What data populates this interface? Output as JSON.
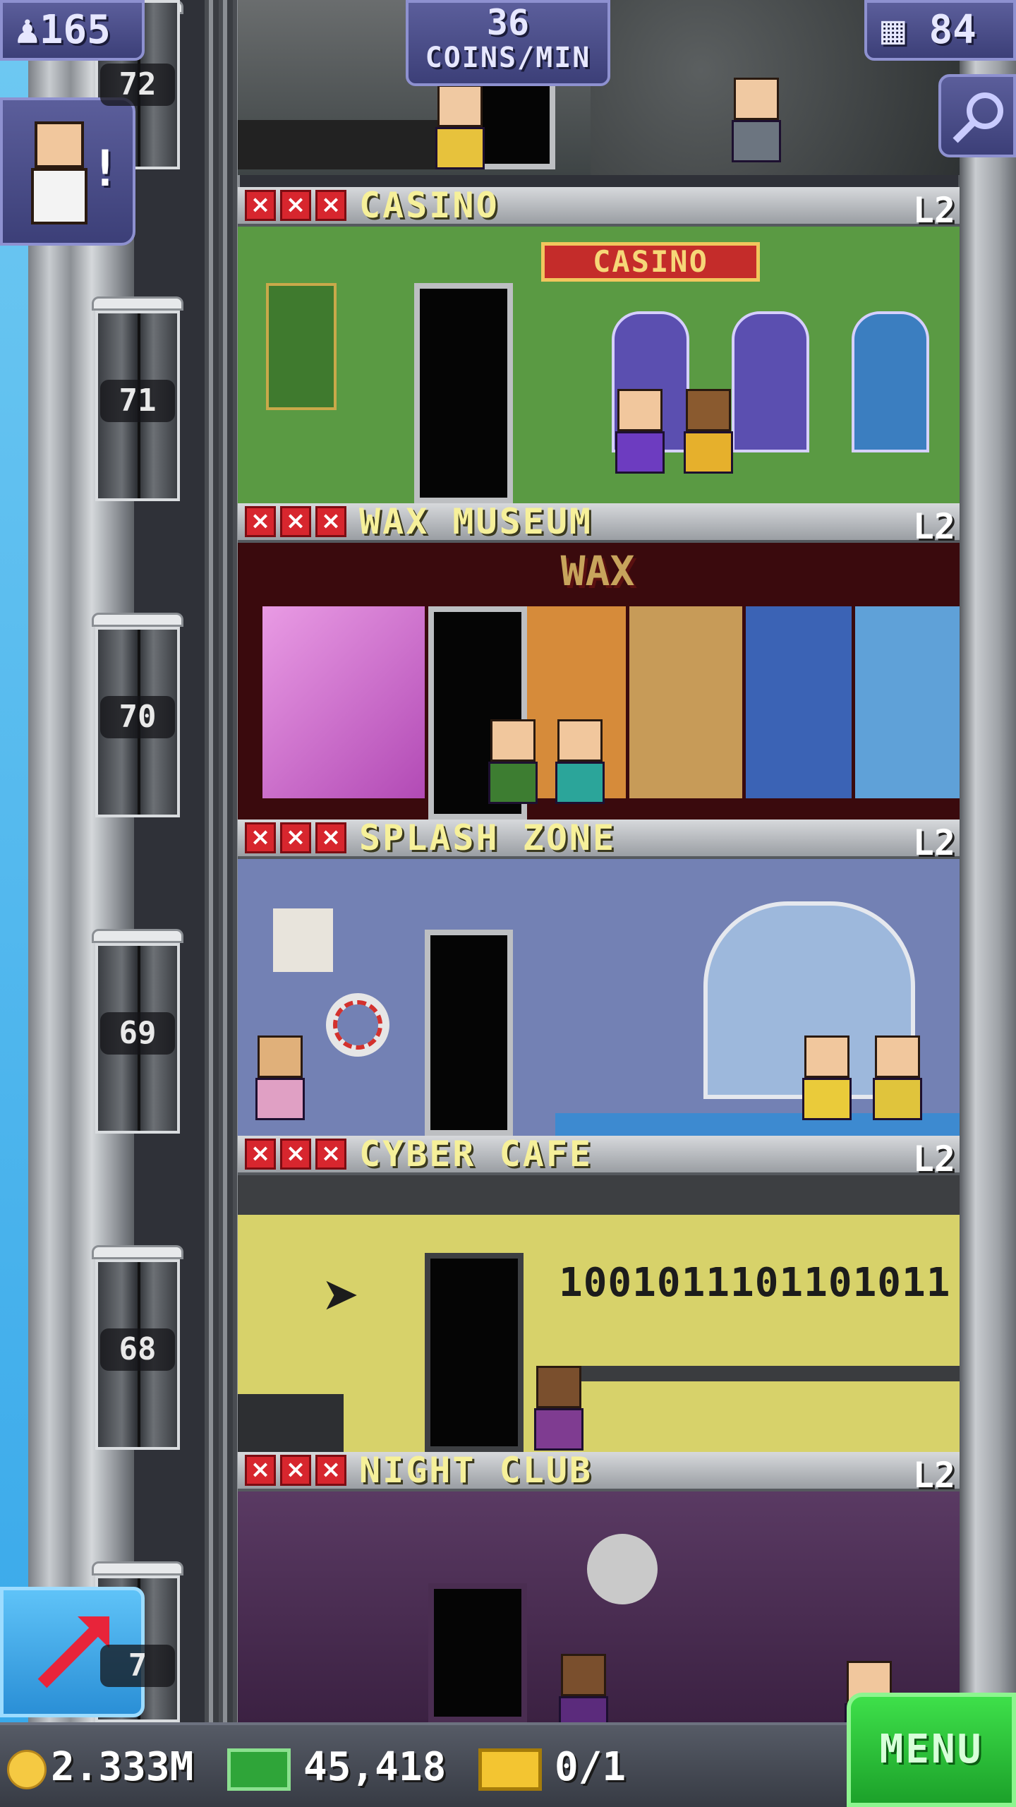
{
  "hud": {
    "population": "165",
    "coins_rate_value": "36",
    "coins_rate_unit": "COINS/MIN",
    "floor_count": "84"
  },
  "elevator": {
    "floor_numbers": [
      "72",
      "71",
      "70",
      "69",
      "68",
      "7"
    ]
  },
  "floors": [
    {
      "name": "CASINO",
      "level": "L2",
      "sign": "CASINO"
    },
    {
      "name": "WAX MUSEUM",
      "level": "L2",
      "sign": "WAX"
    },
    {
      "name": "SPLASH ZONE",
      "level": "L2"
    },
    {
      "name": "CYBER CAFE",
      "level": "L2",
      "binary": "1001011101101011"
    },
    {
      "name": "NIGHT CLUB",
      "level": "L2"
    }
  ],
  "bottom": {
    "coins": "2.333M",
    "bux": "45,418",
    "tickets": "0/1",
    "menu_label": "MENU"
  },
  "icons": {
    "population": "person-icon",
    "floors": "building-icon",
    "search": "magnifier-icon",
    "build": "arrow-up-right-icon",
    "coin": "coin-icon",
    "bux": "bux-icon",
    "ticket": "ticket-icon"
  },
  "colors": {
    "floor_name": "#f6f09a",
    "star_empty": "#d7262e",
    "menu_button": "#2fcf3d",
    "hud_panel": "#4a4d8a"
  }
}
